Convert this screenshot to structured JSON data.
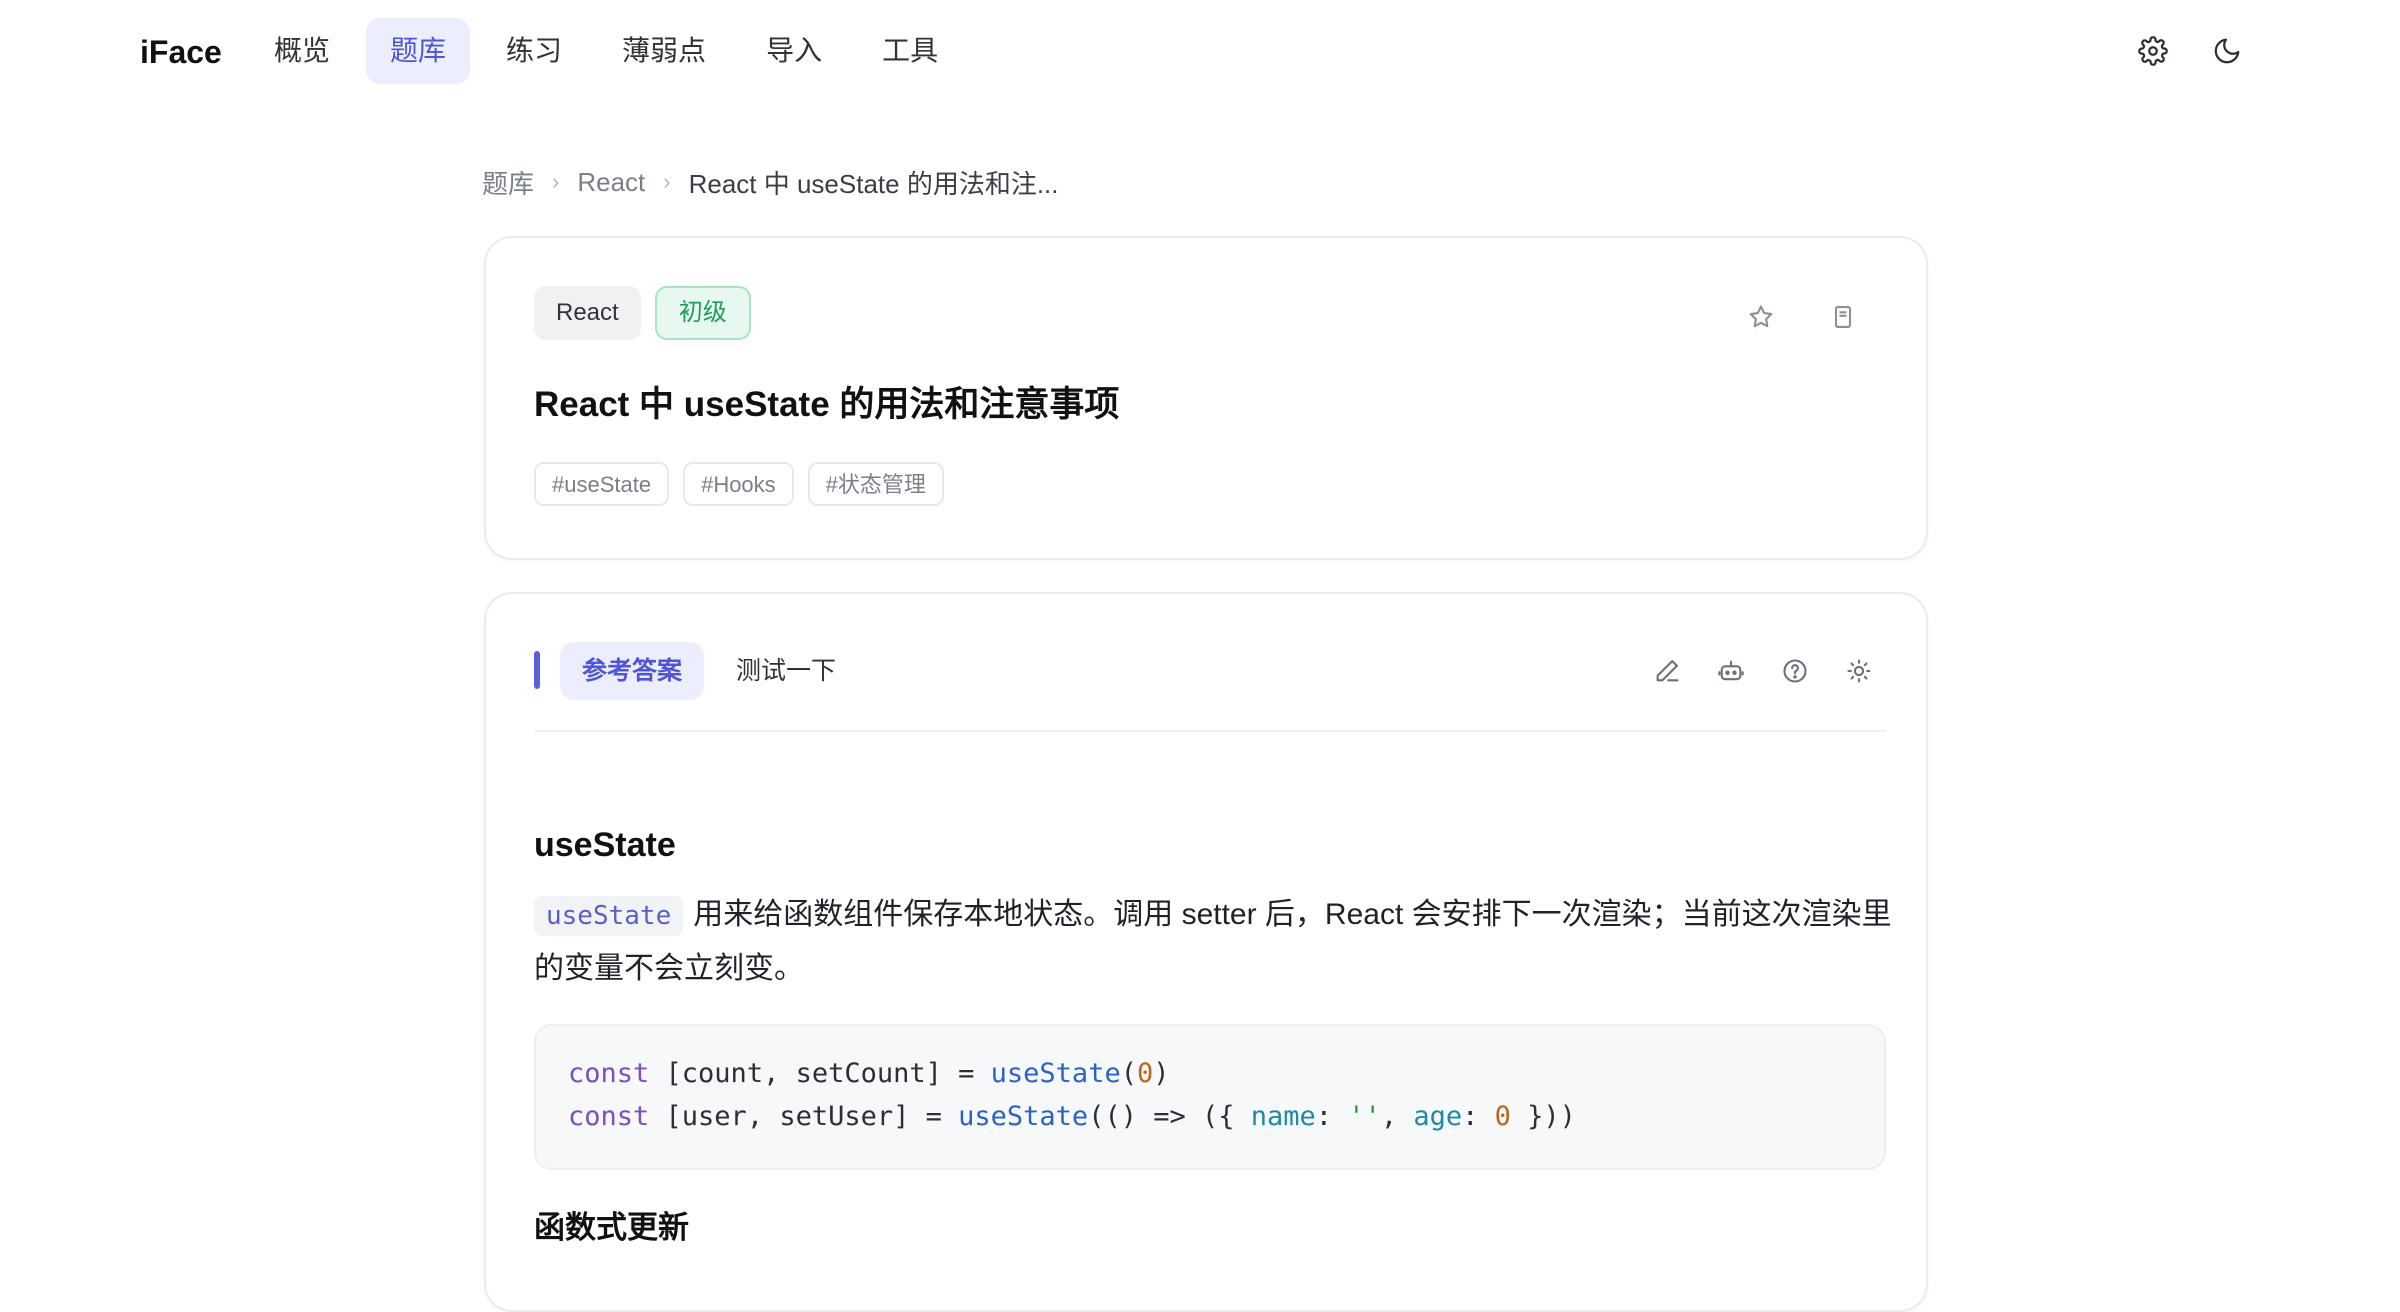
{
  "nav": {
    "logo": "iFace",
    "items": [
      {
        "label": "概览",
        "active": false
      },
      {
        "label": "题库",
        "active": true
      },
      {
        "label": "练习",
        "active": false
      },
      {
        "label": "薄弱点",
        "active": false
      },
      {
        "label": "导入",
        "active": false
      },
      {
        "label": "工具",
        "active": false
      }
    ],
    "icons": [
      "gear-icon",
      "moon-icon"
    ]
  },
  "breadcrumb": {
    "items": [
      "题库",
      "React",
      "React 中 useState 的用法和注..."
    ]
  },
  "question": {
    "category": "React",
    "level": "初级",
    "title": "React 中 useState 的用法和注意事项",
    "tags": [
      "#useState",
      "#Hooks",
      "#状态管理"
    ],
    "icons": [
      "star-icon",
      "bookmark-icon"
    ]
  },
  "answer": {
    "tabs": [
      {
        "label": "参考答案",
        "active": true
      },
      {
        "label": "测试一下",
        "active": false
      }
    ],
    "toolbar_icons": [
      "pencil-icon",
      "robot-icon",
      "help-circle-icon",
      "sun-icon"
    ],
    "heading": "useState",
    "inline_code": "useState",
    "paragraph": "用来给函数组件保存本地状态。调用 setter 后，React 会安排下一次渲染；当前这次渲染里的变量不会立刻变。",
    "code_lines": [
      "const [count, setCount] = useState(0)",
      "const [user, setUser] = useState(() => ({ name: '', age: 0 }))"
    ],
    "subheading": "函数式更新"
  },
  "colors": {
    "accent": "#4f55d6",
    "accent_bg": "#eceefe",
    "level_green": "#1f9e5b"
  }
}
